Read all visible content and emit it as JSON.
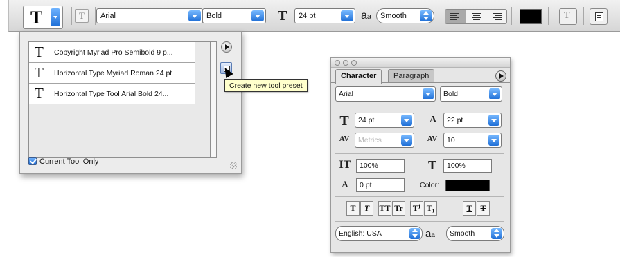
{
  "options_bar": {
    "tool_preset_glyph": "T",
    "orientation_glyph": "T",
    "font_family": "Arial",
    "font_style": "Bold",
    "size_glyph": "T",
    "font_size": "24 pt",
    "antialias_glyph_big": "a",
    "antialias_glyph_small": "a",
    "antialias_method": "Smooth",
    "alignment": [
      "left",
      "center",
      "right"
    ],
    "active_alignment": "left",
    "text_color": "#000000",
    "warp_glyph": "T"
  },
  "tool_presets": {
    "items": [
      {
        "glyph": "T",
        "label": "Copyright Myriad Pro Semibold 9 p..."
      },
      {
        "glyph": "T",
        "label": "Horizontal Type Myriad Roman 24 pt"
      },
      {
        "glyph": "T",
        "label": "Horizontal Type Tool Arial Bold 24..."
      }
    ],
    "tooltip": "Create new tool preset",
    "current_tool_only": "Current Tool Only"
  },
  "character_panel": {
    "tabs": [
      "Character",
      "Paragraph"
    ],
    "font_family": "Arial",
    "font_style": "Bold",
    "font_size": "24 pt",
    "leading": "22 pt",
    "kerning": "Metrics",
    "tracking": "10",
    "vertical_scale": "100%",
    "horizontal_scale": "100%",
    "baseline_shift": "0 pt",
    "color_label": "Color:",
    "color": "#000000",
    "style_buttons": [
      "T",
      "T",
      "TT",
      "Tr",
      "T¹",
      "T₁",
      "T",
      "T"
    ],
    "language": "English: USA",
    "antialias_glyph_big": "a",
    "antialias_glyph_small": "a",
    "antialias_method": "Smooth",
    "glyphs": {
      "size": "T",
      "leading": "A",
      "kerning": "AV",
      "tracking": "AV",
      "vscale": "IT",
      "hscale": "T",
      "baseline": "A"
    }
  }
}
